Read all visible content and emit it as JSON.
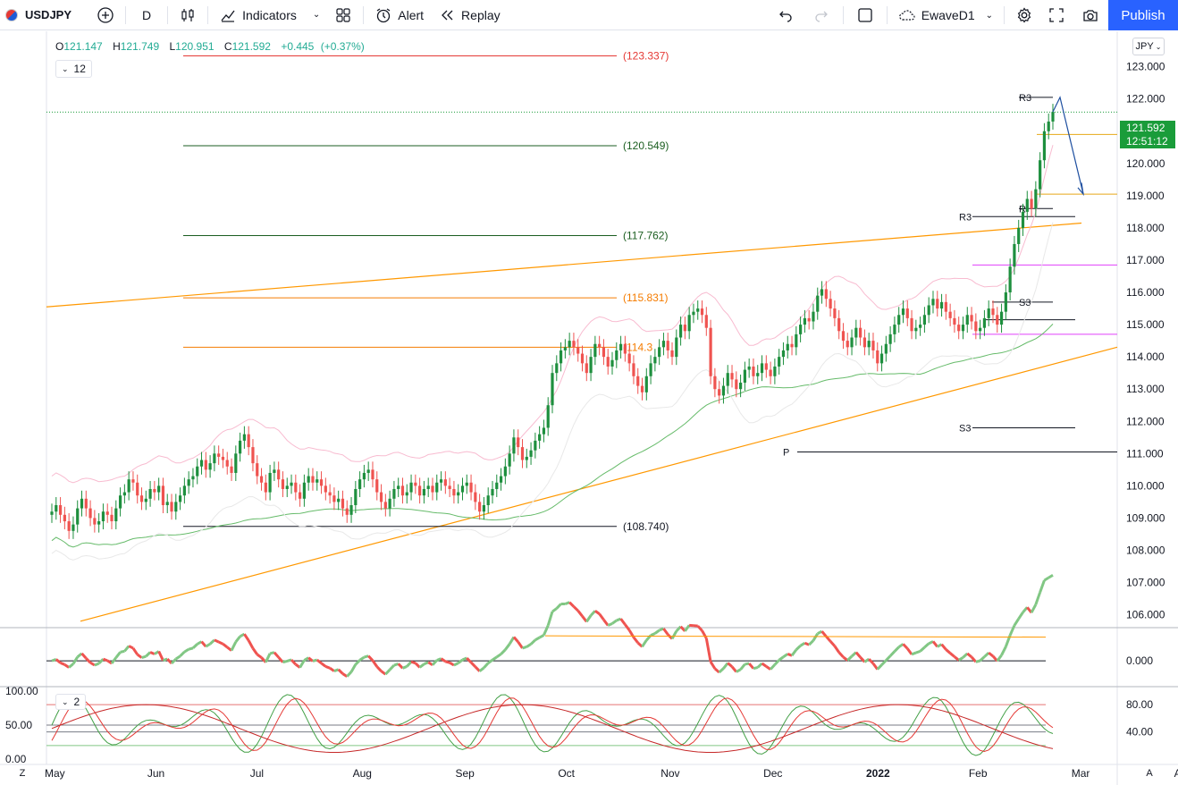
{
  "toolbar": {
    "symbol": "USDJPY",
    "interval": "D",
    "indicators_label": "Indicators",
    "alert_label": "Alert",
    "replay_label": "Replay",
    "layout_name": "EwaveD1",
    "publish_label": "Publish"
  },
  "legend": {
    "open_label": "O",
    "open": "121.147",
    "high_label": "H",
    "high": "121.749",
    "low_label": "L",
    "low": "120.951",
    "close_label": "C",
    "close": "121.592",
    "change": "+0.445",
    "change_pct": "(+0.37%)"
  },
  "indicator_pill_main": "12",
  "indicator_pill_stoch": "2",
  "currency": "JPY",
  "price_badge": {
    "price": "121.592",
    "countdown": "12:51:12"
  },
  "corner_left": "Z",
  "corner_right": "A",
  "colors": {
    "up": "#1e8f3e",
    "down": "#ef5350",
    "fib_red": "#e53935",
    "fib_green": "#1b5e20",
    "fib_orange": "#f57c00",
    "channel": "#ff9800",
    "accent": "#2962ff",
    "magenta": "#e040fb"
  },
  "chart_data": [
    {
      "type": "candlestick",
      "title": "USDJPY",
      "ylim": [
        105.6,
        124.1
      ],
      "price_ticks": [
        "123.000",
        "122.000",
        "121.000",
        "120.000",
        "119.000",
        "118.000",
        "117.000",
        "116.000",
        "115.000",
        "114.000",
        "113.000",
        "112.000",
        "111.000",
        "110.000",
        "109.000",
        "108.000",
        "107.000",
        "106.000"
      ],
      "price_tick_values": [
        123,
        122,
        121,
        120,
        119,
        118,
        117,
        116,
        115,
        114,
        113,
        112,
        111,
        110,
        109,
        108,
        107,
        106
      ],
      "x_labels": [
        "May",
        "Jun",
        "Jul",
        "Aug",
        "Sep",
        "Oct",
        "Nov",
        "Dec",
        "2022",
        "Feb",
        "Mar",
        "Apr"
      ],
      "x_label_index": [
        0,
        24,
        48,
        72,
        96,
        120,
        144,
        168,
        192,
        216,
        240,
        264
      ],
      "fib_levels": [
        {
          "value": 123.337,
          "label": "(123.337)",
          "color": "#e53935"
        },
        {
          "value": 120.549,
          "label": "(120.549)",
          "color": "#1b5e20"
        },
        {
          "value": 117.762,
          "label": "(117.762)",
          "color": "#1b5e20"
        },
        {
          "value": 115.831,
          "label": "(115.831)",
          "color": "#f57c00"
        },
        {
          "value": 114.3,
          "label": "(114.3",
          "color": "#f57c00"
        },
        {
          "value": 108.74,
          "label": "(108.740)",
          "color": "#131722"
        }
      ],
      "pivot_labels": [
        {
          "label": "R3",
          "value": 122.05
        },
        {
          "label": "R3",
          "value": 118.35
        },
        {
          "label": "S3",
          "value": 115.7
        },
        {
          "label": "S3",
          "value": 111.8
        },
        {
          "label": "P",
          "value": 111.05
        },
        {
          "label": "R",
          "value": 118.6
        }
      ],
      "closes": [
        109.2,
        109.4,
        109.1,
        108.9,
        108.6,
        108.8,
        109.3,
        109.6,
        109.3,
        109.0,
        108.8,
        108.9,
        109.2,
        109.1,
        108.9,
        109.3,
        109.7,
        109.8,
        110.2,
        110.1,
        109.7,
        109.5,
        109.6,
        109.9,
        109.8,
        110.0,
        109.4,
        109.5,
        109.2,
        109.5,
        109.7,
        110.0,
        110.2,
        110.3,
        110.6,
        110.8,
        110.5,
        110.7,
        111.0,
        110.9,
        110.8,
        110.6,
        110.4,
        111.0,
        111.4,
        111.6,
        111.2,
        110.7,
        110.3,
        110.1,
        109.8,
        110.4,
        110.5,
        110.2,
        109.9,
        110.0,
        110.1,
        109.8,
        109.6,
        110.1,
        110.3,
        110.1,
        110.2,
        110.0,
        109.8,
        109.7,
        109.5,
        109.6,
        109.3,
        109.1,
        109.4,
        109.9,
        110.2,
        110.4,
        110.5,
        110.2,
        109.8,
        109.5,
        109.3,
        109.6,
        109.9,
        110.0,
        109.7,
        109.8,
        110.1,
        110.0,
        109.7,
        109.9,
        110.0,
        109.8,
        110.1,
        110.2,
        110.0,
        109.9,
        109.7,
        109.8,
        110.0,
        110.1,
        109.8,
        109.5,
        109.2,
        109.4,
        109.7,
        109.9,
        110.1,
        110.3,
        110.6,
        111.0,
        111.5,
        111.2,
        110.8,
        110.9,
        111.1,
        111.4,
        111.6,
        111.8,
        112.5,
        113.5,
        113.8,
        114.2,
        114.3,
        114.5,
        114.3,
        114.1,
        113.8,
        113.5,
        114.0,
        114.4,
        114.3,
        114.0,
        113.7,
        113.9,
        114.2,
        114.4,
        114.1,
        113.8,
        113.4,
        113.1,
        112.9,
        113.4,
        113.8,
        114.0,
        114.3,
        114.5,
        114.2,
        114.0,
        114.6,
        115.0,
        114.8,
        115.3,
        115.4,
        115.5,
        115.3,
        114.9,
        113.4,
        113.0,
        112.8,
        113.1,
        113.5,
        113.3,
        113.0,
        113.2,
        113.6,
        113.7,
        113.4,
        113.5,
        113.8,
        113.6,
        113.4,
        113.7,
        114.0,
        114.2,
        114.4,
        114.3,
        114.7,
        115.0,
        115.2,
        115.1,
        115.4,
        115.9,
        116.1,
        115.8,
        115.5,
        115.2,
        114.8,
        114.5,
        114.3,
        114.6,
        114.9,
        114.6,
        114.3,
        114.5,
        114.2,
        113.8,
        114.1,
        114.4,
        114.7,
        115.0,
        115.3,
        115.5,
        115.2,
        114.8,
        114.9,
        115.0,
        115.3,
        115.6,
        115.8,
        115.5,
        115.7,
        115.4,
        115.2,
        115.0,
        114.8,
        115.0,
        115.3,
        115.1,
        114.8,
        114.9,
        115.2,
        115.5,
        115.3,
        115.0,
        115.4,
        116.0,
        116.8,
        117.5,
        118.0,
        118.5,
        118.9,
        118.6,
        119.2,
        120.1,
        121.0,
        121.3,
        121.6
      ]
    },
    {
      "type": "line",
      "title": "",
      "ylim": [
        -0.6,
        0.75
      ],
      "y_ticks": [
        "0.000"
      ],
      "y_tick_values": [
        0
      ]
    },
    {
      "type": "line",
      "title": "",
      "ylim": [
        -5,
        105
      ],
      "left_ticks": [
        "100.00",
        "50.00",
        "0.00"
      ],
      "left_tick_values": [
        100,
        50,
        0
      ],
      "right_ticks": [
        "80.00",
        "40.00"
      ],
      "right_tick_values": [
        80,
        40
      ],
      "levels": [
        80,
        50,
        40,
        20
      ]
    }
  ]
}
